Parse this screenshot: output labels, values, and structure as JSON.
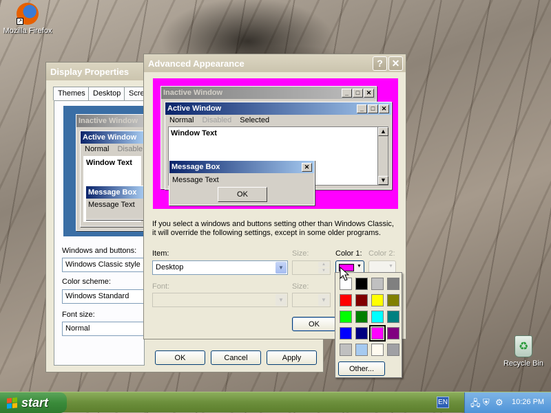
{
  "desktop": {
    "icons": [
      {
        "label": "Mozilla Firefox",
        "icon": "firefox-icon"
      },
      {
        "label": "Recycle Bin",
        "icon": "recycle-bin-icon"
      }
    ]
  },
  "display_properties": {
    "title": "Display Properties",
    "tabs": [
      "Themes",
      "Desktop",
      "Scre"
    ],
    "preview": {
      "inactive_title": "Inactive Window",
      "active_title": "Active Window",
      "menu": [
        "Normal",
        "Disable"
      ],
      "window_text": "Window Text",
      "message_box_title": "Message Box",
      "message_text": "Message Text"
    },
    "windows_buttons_label": "Windows and buttons:",
    "windows_buttons_value": "Windows Classic style",
    "color_scheme_label": "Color scheme:",
    "color_scheme_value": "Windows Standard",
    "font_size_label": "Font size:",
    "font_size_value": "Normal",
    "ok": "OK",
    "cancel": "Cancel",
    "apply": "Apply"
  },
  "advanced_appearance": {
    "title": "Advanced Appearance",
    "help_icon": "?",
    "close_icon": "✕",
    "preview": {
      "inactive_title": "Inactive Window",
      "active_title": "Active Window",
      "menu_normal": "Normal",
      "menu_disabled": "Disabled",
      "menu_selected": "Selected",
      "window_text": "Window Text",
      "message_box_title": "Message Box",
      "message_text": "Message Text",
      "ok": "OK",
      "background_color": "#ff00ff"
    },
    "note_line1": "If you select a windows and buttons setting other than Windows Classic,",
    "note_line2": "it will override the following settings, except in some older programs.",
    "item_label": "Item:",
    "item_value": "Desktop",
    "size_label": "Size:",
    "color1_label": "Color 1:",
    "color2_label": "Color 2:",
    "font_label": "Font:",
    "font_size_label": "Size:",
    "ok": "OK",
    "color1_value": "#ff00ff"
  },
  "palette": {
    "colors": [
      "#ffffff",
      "#000000",
      "#c0c0c0",
      "#808080",
      "#ff0000",
      "#800000",
      "#ffff00",
      "#808000",
      "#00ff00",
      "#008000",
      "#00ffff",
      "#008080",
      "#0000ff",
      "#000080",
      "#ff00ff",
      "#800080",
      "#c0c0c0",
      "#a6caf0",
      "#fffbf0",
      "#a0a0a4"
    ],
    "selected_index": 14,
    "other_label": "Other..."
  },
  "taskbar": {
    "start_label": "start",
    "language": "EN",
    "clock": "10:26 PM"
  }
}
